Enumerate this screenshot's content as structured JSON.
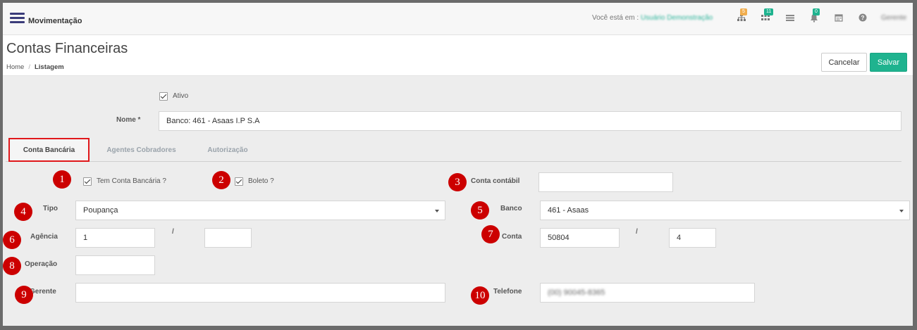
{
  "topbar": {
    "module": "Movimentação",
    "you_are_label": "Você está em :",
    "location": "Usuário Demonstração",
    "icons": [
      {
        "name": "sitemap-icon",
        "badge": "5",
        "badge_color": "#f0ad4e"
      },
      {
        "name": "grid-icon",
        "badge": "11",
        "badge_color": "#1fb38f"
      },
      {
        "name": "list-icon",
        "badge": "",
        "badge_color": ""
      },
      {
        "name": "bell-icon",
        "badge": "0",
        "badge_color": "#1fb38f"
      },
      {
        "name": "calendar-icon",
        "badge": "",
        "badge_color": ""
      },
      {
        "name": "help-icon",
        "badge": "",
        "badge_color": ""
      }
    ],
    "user": "Gerente"
  },
  "header": {
    "title": "Contas Financeiras",
    "breadcrumb": {
      "home": "Home",
      "sep": "/",
      "current": "Listagem"
    },
    "cancel_label": "Cancelar",
    "save_label": "Salvar"
  },
  "form": {
    "ativo_label": "Ativo",
    "nome_label": "Nome *",
    "nome_value": "Banco: 461 - Asaas I.P S.A"
  },
  "tabs": [
    "Conta Bancária",
    "Agentes Cobradores",
    "Autorização"
  ],
  "bank": {
    "tem_conta_label": "Tem Conta Bancária ?",
    "boleto_label": "Boleto ?",
    "conta_contabil_label": "Conta contábil",
    "conta_contabil_value": "",
    "tipo_label": "Tipo",
    "tipo_value": "Poupança",
    "banco_label": "Banco",
    "banco_value": "461 - Asaas",
    "agencia_label": "Agência",
    "agencia_value": "1",
    "agencia_digito": "",
    "slash": "/",
    "conta_label": "Conta",
    "conta_value": "50804",
    "conta_digito": "4",
    "operacao_label": "Operação",
    "operacao_value": "",
    "gerente_label": "Gerente",
    "gerente_value": "",
    "telefone_label": "Telefone",
    "telefone_value": "(00) 90045-8365"
  },
  "annotations": [
    "1",
    "2",
    "3",
    "4",
    "5",
    "6",
    "7",
    "8",
    "9",
    "10"
  ],
  "colors": {
    "accent": "#1fb38f",
    "marker": "#cc0000",
    "tab_highlight": "#e0181b",
    "nav_icon": "#3b3c7a"
  }
}
